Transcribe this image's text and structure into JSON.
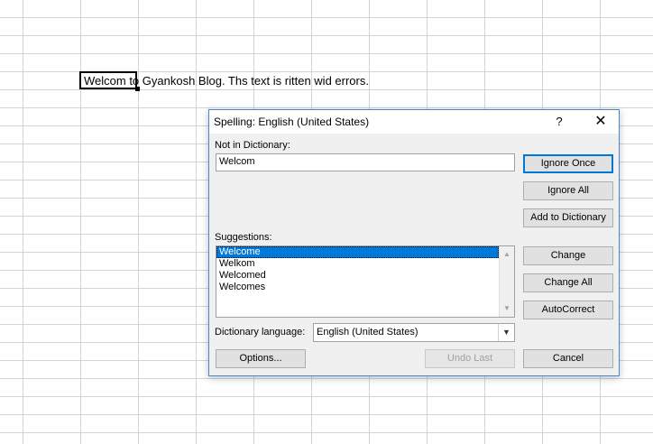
{
  "sheet": {
    "cell_text": "Welcom to Gyankosh Blog. Ths text is ritten wid errors."
  },
  "dialog": {
    "title": "Spelling: English (United States)",
    "help_label": "?",
    "close_label": "✕",
    "not_in_dictionary_label": "Not in Dictionary:",
    "not_in_dictionary_value": "Welcom",
    "suggestions_label": "Suggestions:",
    "suggestions": [
      "Welcome",
      "Welkom",
      "Welcomed",
      "Welcomes"
    ],
    "dictionary_language_label": "Dictionary language:",
    "dictionary_language_value": "English (United States)",
    "buttons": {
      "ignore_once": "Ignore Once",
      "ignore_all": "Ignore All",
      "add_to_dictionary": "Add to Dictionary",
      "change": "Change",
      "change_all": "Change All",
      "autocorrect": "AutoCorrect",
      "options": "Options...",
      "undo_last": "Undo Last",
      "cancel": "Cancel"
    }
  }
}
